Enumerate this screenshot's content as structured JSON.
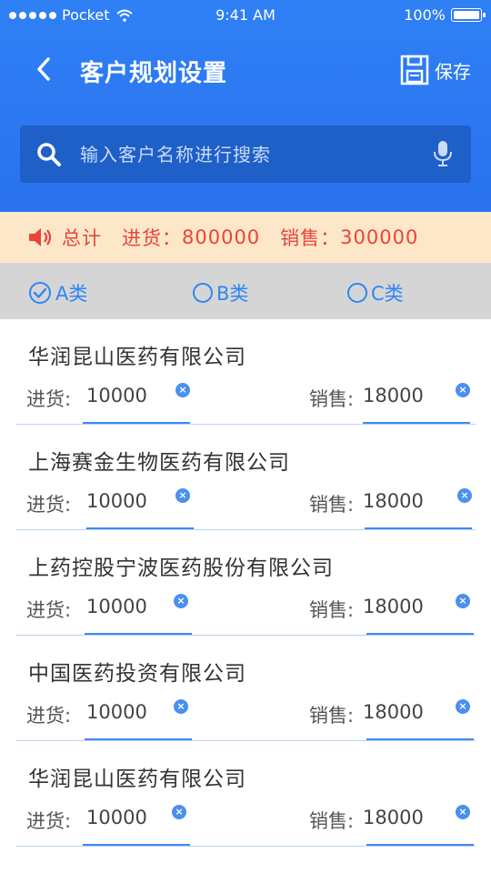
{
  "status_bar": {
    "carrier": "Pocket",
    "time": "9:41 AM",
    "battery": "100%"
  },
  "nav": {
    "title": "客户规划设置",
    "save_label": "保存"
  },
  "search": {
    "placeholder": "输入客户名称进行搜索",
    "value": ""
  },
  "summary": {
    "total_label": "总计",
    "purchase_label": "进货：",
    "purchase_value": "800000",
    "sales_label": "销售：",
    "sales_value": "300000"
  },
  "filters": [
    {
      "label": "A类",
      "checked": true
    },
    {
      "label": "B类",
      "checked": false
    },
    {
      "label": "C类",
      "checked": false
    }
  ],
  "field_labels": {
    "purchase": "进货:",
    "sales": "销售:"
  },
  "customers": [
    {
      "name": "华润昆山医药有限公司",
      "purchase": "10000",
      "sales": "18000"
    },
    {
      "name": "上海赛金生物医药有限公司",
      "purchase": "10000",
      "sales": "18000"
    },
    {
      "name": "上药控股宁波医药股份有限公司",
      "purchase": "10000",
      "sales": "18000"
    },
    {
      "name": "中国医药投资有限公司",
      "purchase": "10000",
      "sales": "18000"
    },
    {
      "name": "华润昆山医药有限公司",
      "purchase": "10000",
      "sales": "18000"
    }
  ],
  "colors": {
    "primary": "#2e86f5",
    "header": "#2f80f5",
    "summary_bg": "#fde7c9",
    "summary_text": "#e9443a",
    "filter_bg": "#d5d5d5"
  }
}
